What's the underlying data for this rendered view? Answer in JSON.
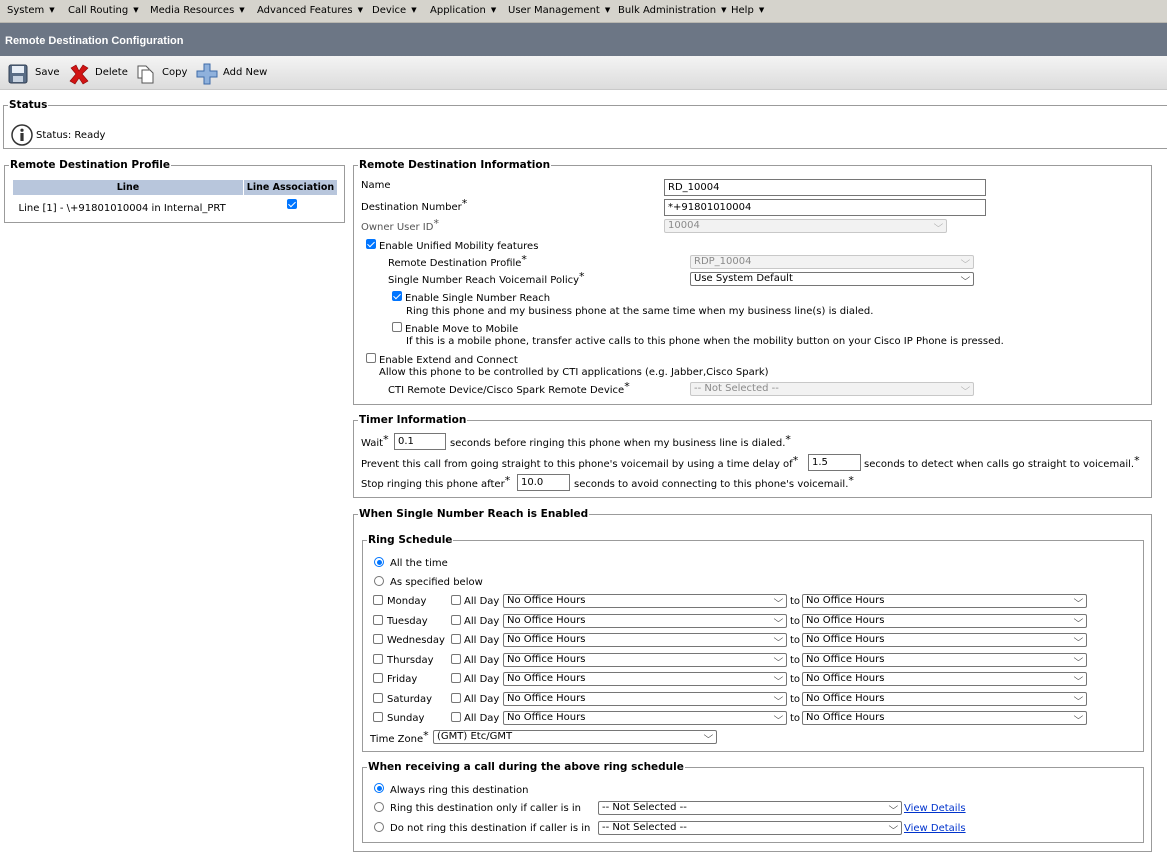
{
  "menu": [
    "System",
    "Call Routing",
    "Media Resources",
    "Advanced Features",
    "Device",
    "Application",
    "User Management",
    "Bulk Administration",
    "Help"
  ],
  "page_title": "Remote Destination Configuration",
  "toolbar": {
    "save": "Save",
    "delete": "Delete",
    "copy": "Copy",
    "add_new": "Add New"
  },
  "status": {
    "legend": "Status",
    "text": "Status: Ready"
  },
  "rdp": {
    "legend": "Remote Destination Profile",
    "col_line": "Line",
    "col_assoc": "Line Association",
    "rows": [
      {
        "line": "Line [1] - \\+91801010004 in Internal_PRT",
        "associated": true
      }
    ]
  },
  "rdi": {
    "legend": "Remote Destination Information",
    "name_label": "Name",
    "name_value": "RD_10004",
    "dest_label": "Destination Number",
    "dest_value": "*+91801010004",
    "owner_label": "Owner User ID",
    "owner_value": "10004",
    "enable_um": "Enable Unified Mobility features",
    "rdp_label": "Remote Destination Profile",
    "rdp_value": "RDP_10004",
    "snr_vm_label": "Single Number Reach Voicemail Policy",
    "snr_vm_value": "Use System Default",
    "enable_snr": "Enable Single Number Reach",
    "snr_desc": "Ring this phone and my business phone at the same time when my business line(s) is dialed.",
    "enable_mtm": "Enable Move to Mobile",
    "mtm_desc": "If this is a mobile phone, transfer active calls to this phone when the mobility button on your Cisco IP Phone is pressed.",
    "enable_ec": "Enable Extend and Connect",
    "ec_desc": "Allow this phone to be controlled by CTI applications (e.g. Jabber,Cisco Spark)",
    "cti_label": "CTI Remote Device/Cisco Spark Remote Device",
    "cti_value": "-- Not Selected --"
  },
  "timer": {
    "legend": "Timer Information",
    "wait_label": "Wait",
    "wait_value": "0.1",
    "wait_suffix": "seconds before ringing this phone when my business line is dialed.",
    "prevent_label": "Prevent this call from going straight to this phone's voicemail by using a time delay of",
    "prevent_value": "1.5",
    "prevent_suffix": "seconds to detect when calls go straight to voicemail.",
    "stop_label": "Stop ringing this phone after",
    "stop_value": "10.0",
    "stop_suffix": "seconds to avoid connecting to this phone's voicemail."
  },
  "snr": {
    "legend": "When Single Number Reach is Enabled",
    "ring_schedule": {
      "legend": "Ring Schedule",
      "all_time": "All the time",
      "as_specified": "As specified below",
      "all_day": "All Day",
      "to": "to",
      "days": [
        {
          "day": "Monday",
          "from": "No Office Hours",
          "to": "No Office Hours"
        },
        {
          "day": "Tuesday",
          "from": "No Office Hours",
          "to": "No Office Hours"
        },
        {
          "day": "Wednesday",
          "from": "No Office Hours",
          "to": "No Office Hours"
        },
        {
          "day": "Thursday",
          "from": "No Office Hours",
          "to": "No Office Hours"
        },
        {
          "day": "Friday",
          "from": "No Office Hours",
          "to": "No Office Hours"
        },
        {
          "day": "Saturday",
          "from": "No Office Hours",
          "to": "No Office Hours"
        },
        {
          "day": "Sunday",
          "from": "No Office Hours",
          "to": "No Office Hours"
        }
      ],
      "tz_label": "Time Zone",
      "tz_value": "(GMT) Etc/GMT"
    },
    "receiving": {
      "legend": "When receiving a call during the above ring schedule",
      "always": "Always ring this destination",
      "only_if": "Ring this destination only if caller is in",
      "not_if": "Do not ring this destination if caller is in",
      "only_if_value": "-- Not Selected --",
      "not_if_value": "-- Not Selected --",
      "view_details": "View Details"
    }
  }
}
